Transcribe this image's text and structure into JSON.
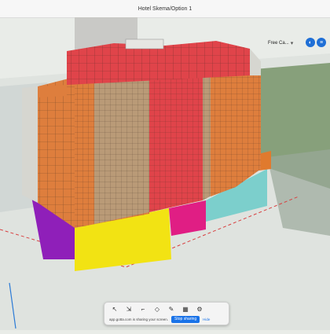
{
  "window": {
    "title": "Hotel Skema/Option 1"
  },
  "view": {
    "camera_label": "Free Ca...",
    "tools": [
      "orbit-icon",
      "layers-icon"
    ]
  },
  "toolbar": {
    "tools": [
      "select-tool-icon",
      "move-tool-icon",
      "crop-tool-icon",
      "fill-tool-icon",
      "draw-tool-icon",
      "grid-tool-icon",
      "gear-icon"
    ]
  },
  "share": {
    "text": "app.gotta.com is sharing your screen.",
    "stop_label": "Stop sharing",
    "hide_label": "Hide"
  },
  "scene": {
    "palette": {
      "red": "#e0444a",
      "orange": "#de7e3d",
      "tan": "#b99a77",
      "magenta": "#e01e84",
      "purple": "#8f1fb9",
      "yellow": "#f2e313",
      "cyan": "#7ccfcc",
      "gray": "#c9c9c3"
    }
  }
}
